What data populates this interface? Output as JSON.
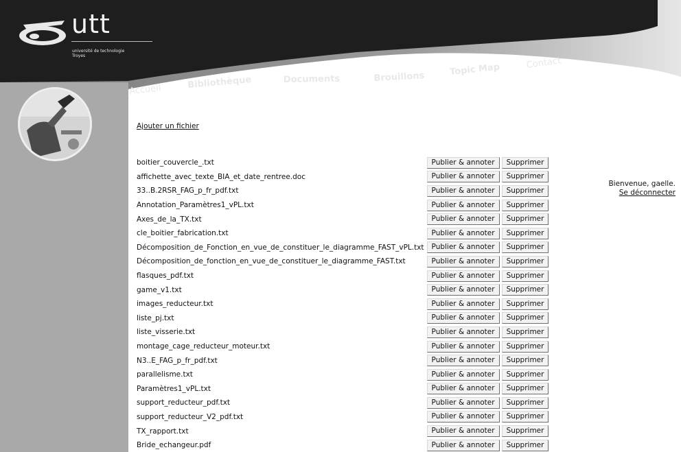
{
  "brand": {
    "name": "utt",
    "subtitle_line1": "université de technologie",
    "subtitle_line2": "Troyes"
  },
  "nav": {
    "home": "Accueil",
    "library": "Bibliothèque",
    "documents": "Documents",
    "drafts": "Brouillons",
    "topic_map": "Topic Map",
    "contact": "Contact"
  },
  "user": {
    "welcome": "Bienvenue, gaelle.",
    "logout": "Se déconnecter"
  },
  "main": {
    "add_file_link": "Ajouter un fichier",
    "publish_label": "Publier & annoter",
    "delete_label": "Supprimer",
    "files": [
      "boitier_couvercle_.txt",
      "affichette_avec_texte_BIA_et_date_rentree.doc",
      "33..B.2RSR_FAG_p_fr_pdf.txt",
      "Annotation_Paramètres1_vPL.txt",
      "Axes_de_la_TX.txt",
      "cle_boitier_fabrication.txt",
      "Décomposition_de_Fonction_en_vue_de_constituer_le_diagramme_FAST_vPL.txt",
      "Décomposition_de_fonction_en_vue_de_constituer_le_diagramme_FAST.txt",
      "flasques_pdf.txt",
      "game_v1.txt",
      "images_reducteur.txt",
      "liste_pj.txt",
      "liste_visserie.txt",
      "montage_cage_reducteur_moteur.txt",
      "N3..E_FAG_p_fr_pdf.txt",
      "parallelisme.txt",
      "Paramètres1_vPL.txt",
      "support_reducteur_pdf.txt",
      "support_reducteur_V2_pdf.txt",
      "TX_rapport.txt",
      "Bride_echangeur.pdf"
    ]
  },
  "colors": {
    "header_dark": "#1e1e1e",
    "header_band": "#8c8c8c",
    "sidebar": "#a9a9a9",
    "background": "#ffffff"
  }
}
